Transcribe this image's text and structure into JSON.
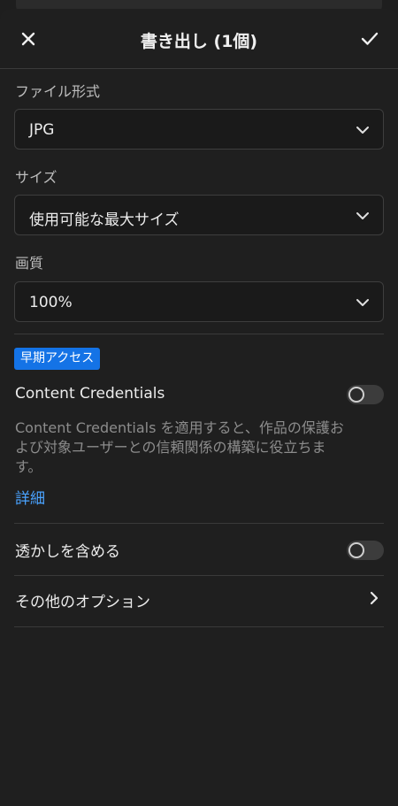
{
  "header": {
    "title": "書き出し (1個)"
  },
  "file_format": {
    "label": "ファイル形式",
    "value": "JPG"
  },
  "size": {
    "label": "サイズ",
    "value": "使用可能な最大サイズ"
  },
  "quality": {
    "label": "画質",
    "value": "100%"
  },
  "content_credentials": {
    "badge": "早期アクセス",
    "title": "Content Credentials",
    "enabled": false,
    "description": "Content Credentials を適用すると、作品の保護および対象ユーザーとの信頼関係の構築に役立ちます。",
    "link": "詳細"
  },
  "watermark": {
    "label": "透かしを含める",
    "enabled": false
  },
  "other_options": {
    "label": "その他のオプション"
  },
  "colors": {
    "background": "#1f1f1f",
    "accent": "#1473e6",
    "link": "#4aa3ff"
  }
}
